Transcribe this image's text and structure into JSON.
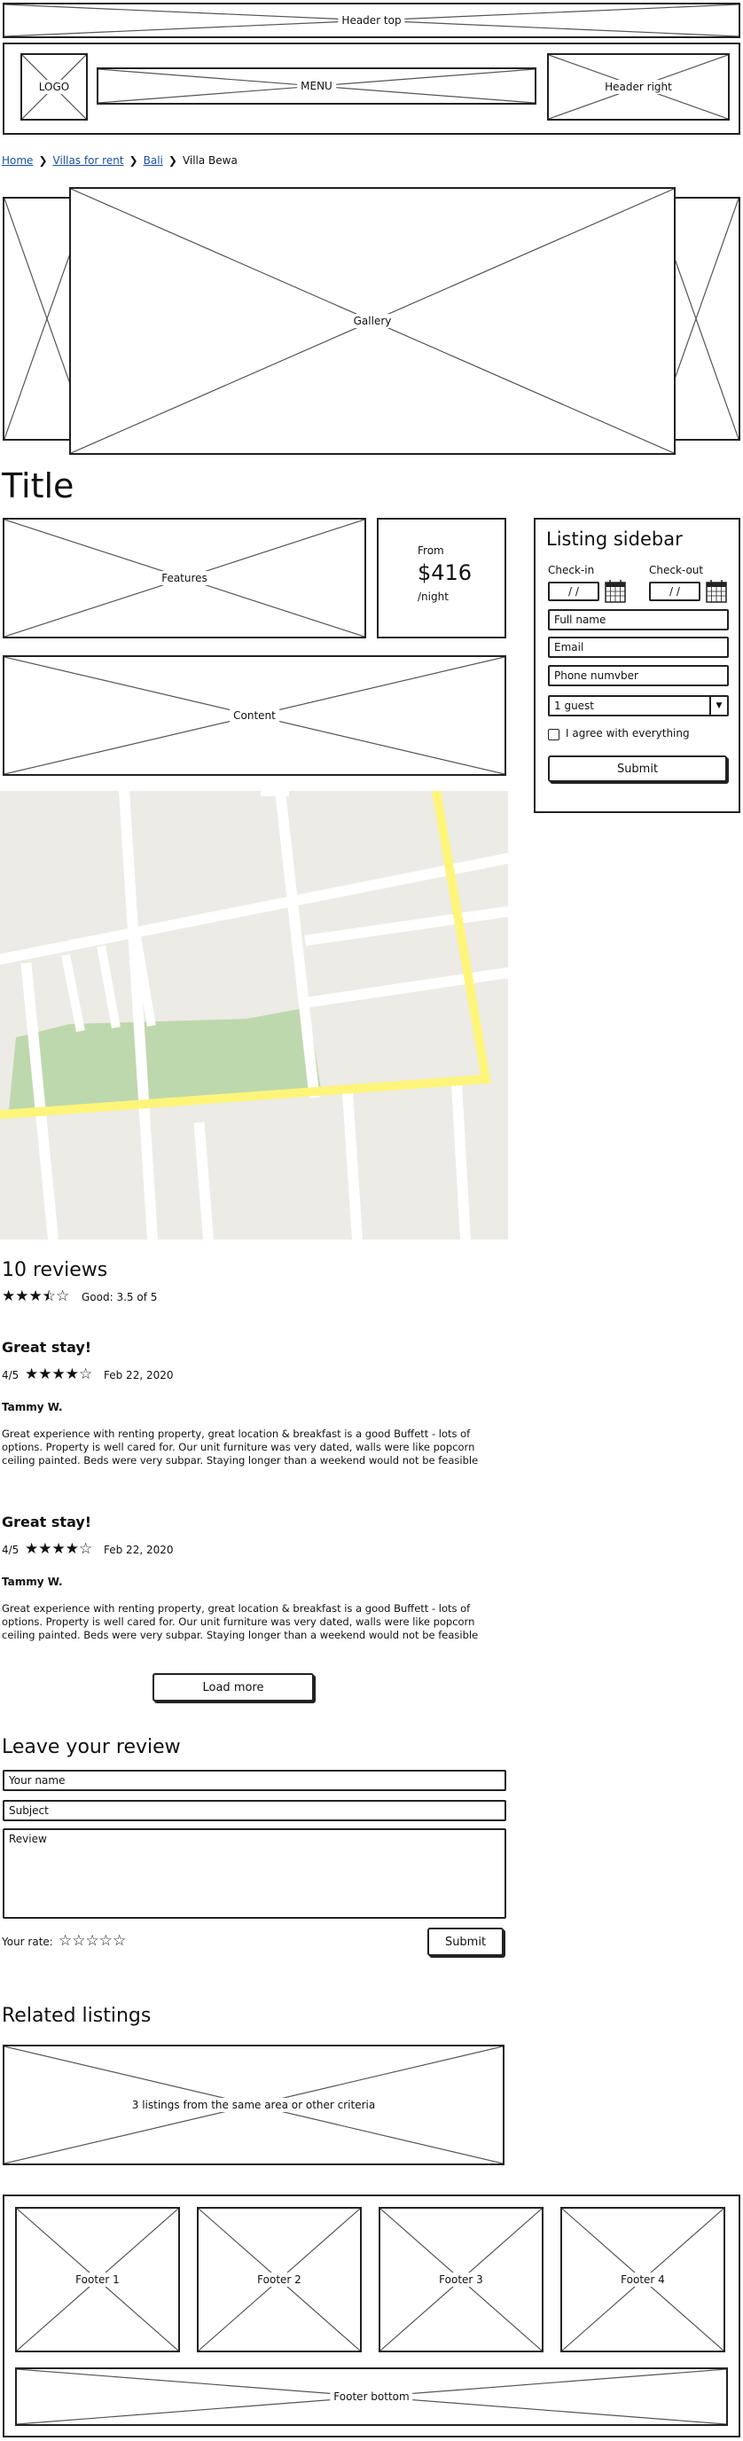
{
  "header": {
    "top_label": "Header top",
    "logo_label": "LOGO",
    "menu_label": "MENU",
    "right_label": "Header right"
  },
  "breadcrumb": {
    "items": [
      "Home",
      "Villas for rent",
      "Bali"
    ],
    "current": "Villa Bewa"
  },
  "gallery": {
    "label": "Gallery"
  },
  "listing": {
    "title": "Title",
    "features_label": "Features",
    "content_label": "Content",
    "price": {
      "from": "From",
      "amount": "$416",
      "per": "/night"
    }
  },
  "sidebar": {
    "title": "Listing sidebar",
    "checkin_label": "Check-in",
    "checkout_label": "Check-out",
    "checkin_value": "/ /",
    "checkout_value": "/ /",
    "fullname_placeholder": "Full name",
    "email_placeholder": "Email",
    "phone_placeholder": "Phone numvber",
    "guests_value": "1 guest",
    "agree_label": "I agree with everything",
    "submit_label": "Submit"
  },
  "map": {
    "colors": {
      "land": "#ecebe5",
      "park": "#bed8ad",
      "road": "#ffffff",
      "highway": "#fff57a"
    }
  },
  "reviews": {
    "heading": "10 reviews",
    "rating_stars": 3.5,
    "summary": "Good: 3.5 of 5",
    "items": [
      {
        "title": "Great stay!",
        "score": "4/5",
        "stars": 4,
        "date": "Feb 22, 2020",
        "author": "Tammy W.",
        "text": "Great experience with renting property, great location & breakfast is a good Buffett - lots of options. Property is well cared for. Our unit furniture was very dated, walls were like popcorn ceiling painted. Beds were very subpar. Staying longer than a weekend would not be feasible"
      },
      {
        "title": "Great stay!",
        "score": "4/5",
        "stars": 4,
        "date": "Feb 22, 2020",
        "author": "Tammy W.",
        "text": "Great experience with renting property, great location & breakfast is a good Buffett - lots of options. Property is well cared for. Our unit furniture was very dated, walls were like popcorn ceiling painted. Beds were very subpar. Staying longer than a weekend would not be feasible"
      }
    ],
    "load_more_label": "Load more"
  },
  "leave_review": {
    "heading": "Leave your review",
    "name_placeholder": "Your name",
    "subject_placeholder": "Subject",
    "review_placeholder": "Review",
    "rate_label": "Your rate:",
    "rate_stars": 0,
    "submit_label": "Submit"
  },
  "related": {
    "heading": "Related listings",
    "label": "3 listings from the same area or other criteria"
  },
  "footer": {
    "columns": [
      "Footer 1",
      "Footer 2",
      "Footer 3",
      "Footer 4"
    ],
    "bottom_label": "Footer bottom"
  }
}
